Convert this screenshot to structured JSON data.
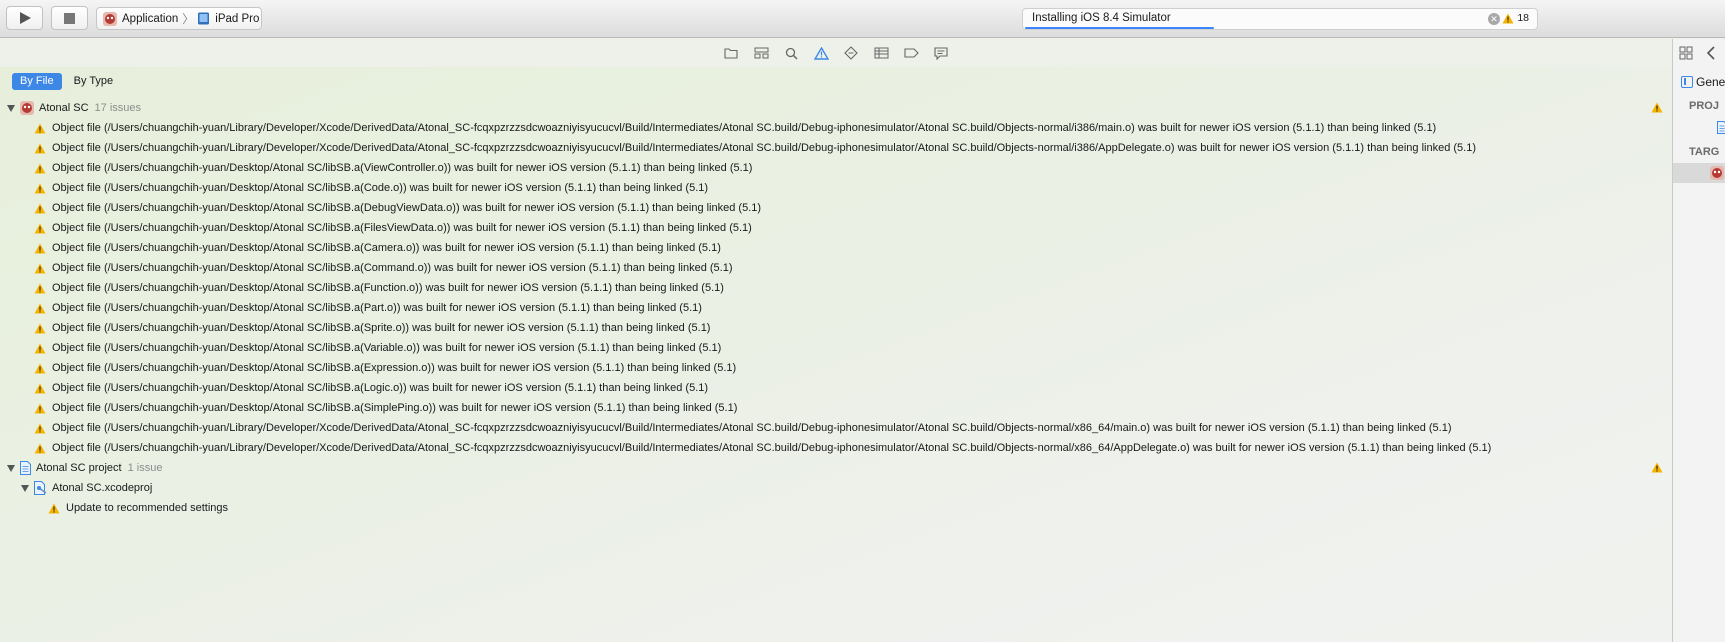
{
  "toolbar": {
    "scheme_name": "Application",
    "destination": "iPad Pro",
    "activity_text": "Installing iOS 8.4 Simulator",
    "activity_progress_fraction": 0.37,
    "warning_count": "18"
  },
  "navigator": {
    "filter_by_file": "By File",
    "filter_by_type": "By Type",
    "groups": [
      {
        "name": "Atonal SC",
        "count": "17 issues",
        "issues": [
          "Object file (/Users/chuangchih-yuan/Library/Developer/Xcode/DerivedData/Atonal_SC-fcqxpzrzzsdcwoazniyisyucucvl/Build/Intermediates/Atonal SC.build/Debug-iphonesimulator/Atonal SC.build/Objects-normal/i386/main.o) was built for newer iOS version (5.1.1) than being linked (5.1)",
          "Object file (/Users/chuangchih-yuan/Library/Developer/Xcode/DerivedData/Atonal_SC-fcqxpzrzzsdcwoazniyisyucucvl/Build/Intermediates/Atonal SC.build/Debug-iphonesimulator/Atonal SC.build/Objects-normal/i386/AppDelegate.o) was built for newer iOS version (5.1.1) than being linked (5.1)",
          "Object file (/Users/chuangchih-yuan/Desktop/Atonal SC/libSB.a(ViewController.o)) was built for newer iOS version (5.1.1) than being linked (5.1)",
          "Object file (/Users/chuangchih-yuan/Desktop/Atonal SC/libSB.a(Code.o)) was built for newer iOS version (5.1.1) than being linked (5.1)",
          "Object file (/Users/chuangchih-yuan/Desktop/Atonal SC/libSB.a(DebugViewData.o)) was built for newer iOS version (5.1.1) than being linked (5.1)",
          "Object file (/Users/chuangchih-yuan/Desktop/Atonal SC/libSB.a(FilesViewData.o)) was built for newer iOS version (5.1.1) than being linked (5.1)",
          "Object file (/Users/chuangchih-yuan/Desktop/Atonal SC/libSB.a(Camera.o)) was built for newer iOS version (5.1.1) than being linked (5.1)",
          "Object file (/Users/chuangchih-yuan/Desktop/Atonal SC/libSB.a(Command.o)) was built for newer iOS version (5.1.1) than being linked (5.1)",
          "Object file (/Users/chuangchih-yuan/Desktop/Atonal SC/libSB.a(Function.o)) was built for newer iOS version (5.1.1) than being linked (5.1)",
          "Object file (/Users/chuangchih-yuan/Desktop/Atonal SC/libSB.a(Part.o)) was built for newer iOS version (5.1.1) than being linked (5.1)",
          "Object file (/Users/chuangchih-yuan/Desktop/Atonal SC/libSB.a(Sprite.o)) was built for newer iOS version (5.1.1) than being linked (5.1)",
          "Object file (/Users/chuangchih-yuan/Desktop/Atonal SC/libSB.a(Variable.o)) was built for newer iOS version (5.1.1) than being linked (5.1)",
          "Object file (/Users/chuangchih-yuan/Desktop/Atonal SC/libSB.a(Expression.o)) was built for newer iOS version (5.1.1) than being linked (5.1)",
          "Object file (/Users/chuangchih-yuan/Desktop/Atonal SC/libSB.a(Logic.o)) was built for newer iOS version (5.1.1) than being linked (5.1)",
          "Object file (/Users/chuangchih-yuan/Desktop/Atonal SC/libSB.a(SimplePing.o)) was built for newer iOS version (5.1.1) than being linked (5.1)",
          "Object file (/Users/chuangchih-yuan/Library/Developer/Xcode/DerivedData/Atonal_SC-fcqxpzrzzsdcwoazniyisyucucvl/Build/Intermediates/Atonal SC.build/Debug-iphonesimulator/Atonal SC.build/Objects-normal/x86_64/main.o) was built for newer iOS version (5.1.1) than being linked (5.1)",
          "Object file (/Users/chuangchih-yuan/Library/Developer/Xcode/DerivedData/Atonal_SC-fcqxpzrzzsdcwoazniyisyucucvl/Build/Intermediates/Atonal SC.build/Debug-iphonesimulator/Atonal SC.build/Objects-normal/x86_64/AppDelegate.o) was built for newer iOS version (5.1.1) than being linked (5.1)"
        ]
      },
      {
        "name": "Atonal SC project",
        "count": "1 issue",
        "subgroup": "Atonal SC.xcodeproj",
        "issues": [
          "Update to recommended settings"
        ]
      }
    ]
  },
  "inspector": {
    "tab_label": "Gener",
    "project_header": "PROJ",
    "targets_header": "TARG"
  },
  "colors": {
    "accent": "#3d87e6",
    "warning": "#f5b400",
    "count_text": "#8d8d8d"
  }
}
